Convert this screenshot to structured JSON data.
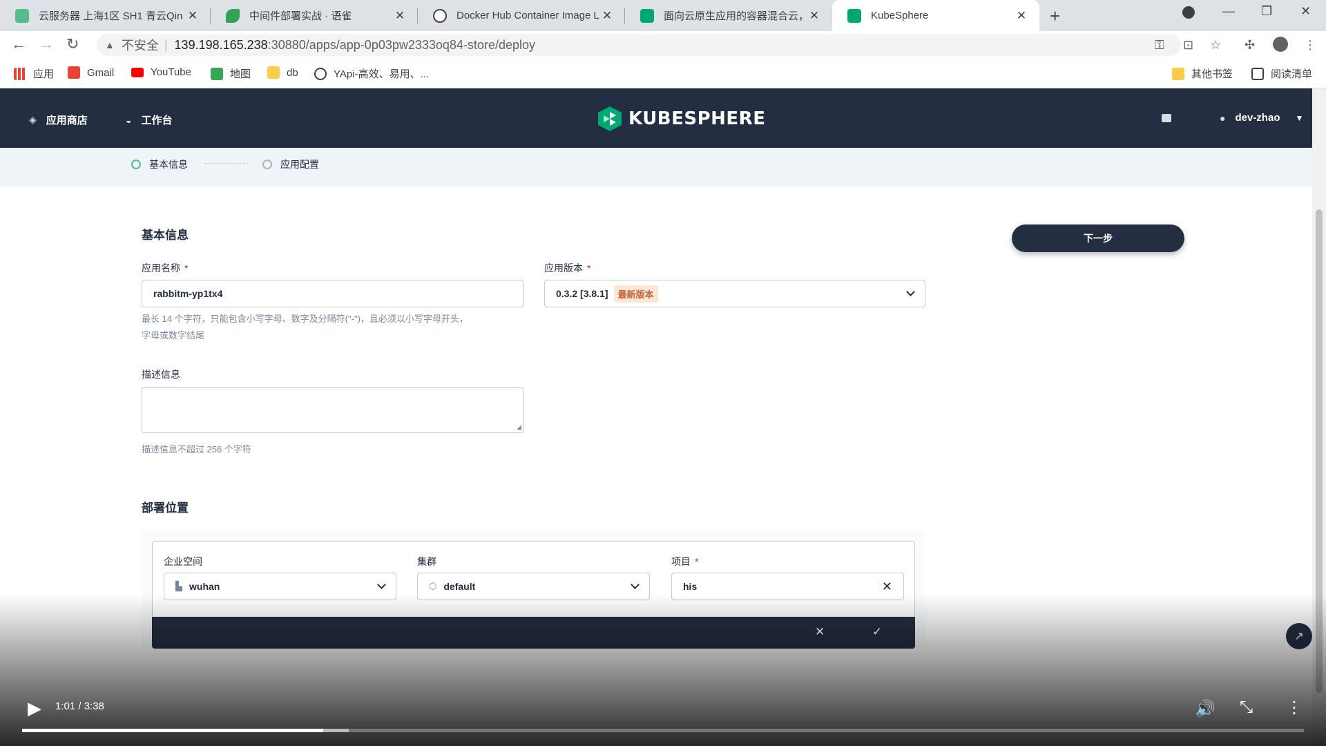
{
  "browser": {
    "tabs": [
      {
        "title": "云服务器 上海1区 SH1 青云Qin",
        "favicon_color": "#55bc8a"
      },
      {
        "title": "中间件部署实战 · 语雀",
        "favicon_color": "#31a354"
      },
      {
        "title": "Docker Hub Container Image L",
        "favicon_color": "#3c4043"
      },
      {
        "title": "面向云原生应用的容器混合云，支",
        "favicon_color": "#00a971"
      },
      {
        "title": "KubeSphere",
        "favicon_color": "#00a971"
      }
    ],
    "address": {
      "insecure_label": "不安全",
      "host": "139.198.165.238",
      "path": ":30880/apps/app-0p03pw2333oq84-store/deploy"
    },
    "bookmarks": [
      {
        "label": "应用",
        "icon": "apps-grid-icon"
      },
      {
        "label": "Gmail",
        "icon": "gmail-icon"
      },
      {
        "label": "YouTube",
        "icon": "youtube-icon"
      },
      {
        "label": "地图",
        "icon": "maps-icon"
      },
      {
        "label": "db",
        "icon": "folder-icon"
      },
      {
        "label": "YApi-高效、易用、...",
        "icon": "yapi-icon"
      }
    ],
    "bookmarks_right": [
      {
        "label": "其他书签",
        "icon": "folder-icon"
      },
      {
        "label": "阅读清单",
        "icon": "reading-list-icon"
      }
    ]
  },
  "app": {
    "nav": {
      "app_store": "应用商店",
      "workbench": "工作台",
      "logo_text": "KUBESPHERE",
      "username": "dev-zhao"
    },
    "steps": [
      {
        "label": "基本信息",
        "active": true
      },
      {
        "label": "应用配置",
        "active": false
      }
    ],
    "form": {
      "section_basic": "基本信息",
      "app_name_label": "应用名称",
      "app_name_value": "rabbitm-yp1tx4",
      "app_name_hint_1": "最长 14 个字符，只能包含小写字母、数字及分隔符(\"-\")，且必须以小写字母开头，",
      "app_name_hint_2": "字母或数字结尾",
      "version_label": "应用版本",
      "version_value": "0.3.2 [3.8.1]",
      "version_badge": "最新版本",
      "desc_label": "描述信息",
      "desc_hint": "描述信息不超过 256 个字符",
      "section_deploy": "部署位置",
      "workspace_label": "企业空间",
      "workspace_value": "wuhan",
      "cluster_label": "集群",
      "cluster_value": "default",
      "project_label": "项目",
      "project_value": "his",
      "next_button": "下一步",
      "required_mark": "*"
    }
  },
  "video": {
    "time": "1:01 / 3:38",
    "progress": 0.235,
    "buffered": 0.255
  }
}
